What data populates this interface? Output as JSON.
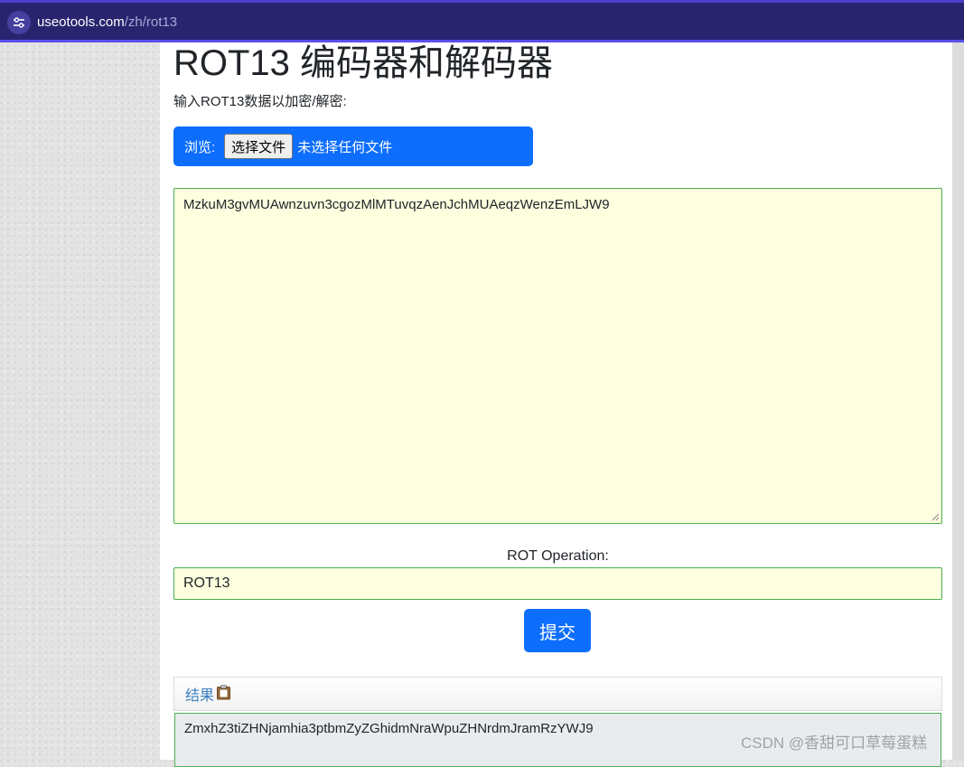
{
  "browser": {
    "url_host": "useotools.com",
    "url_path": "/zh/rot13"
  },
  "page": {
    "title": "ROT13 编码器和解码器",
    "subtitle": "输入ROT13数据以加密/解密:",
    "file": {
      "browse_label": "浏览:",
      "choose_button": "选择文件",
      "no_file_text": "未选择任何文件"
    },
    "input_text": "MzkuM3gvMUAwnzuvn3cgozMlMTuvqzAenJchMUAeqzWenzEmLJW9",
    "operation_label": "ROT Operation:",
    "operation_value": "ROT13",
    "submit_label": "提交",
    "result_label": "结果",
    "result_text": "ZmxhZ3tiZHNjamhia3ptbmZyZGhidmNraWpuZHNrdmJramRzYWJ9"
  },
  "watermark": "CSDN @香甜可口草莓蛋糕",
  "colors": {
    "browser_bar": "#29246e",
    "primary_button": "#0d6efd",
    "input_bg": "#fdffdf",
    "input_border": "#4caf50",
    "result_label": "#3a7fc1"
  }
}
